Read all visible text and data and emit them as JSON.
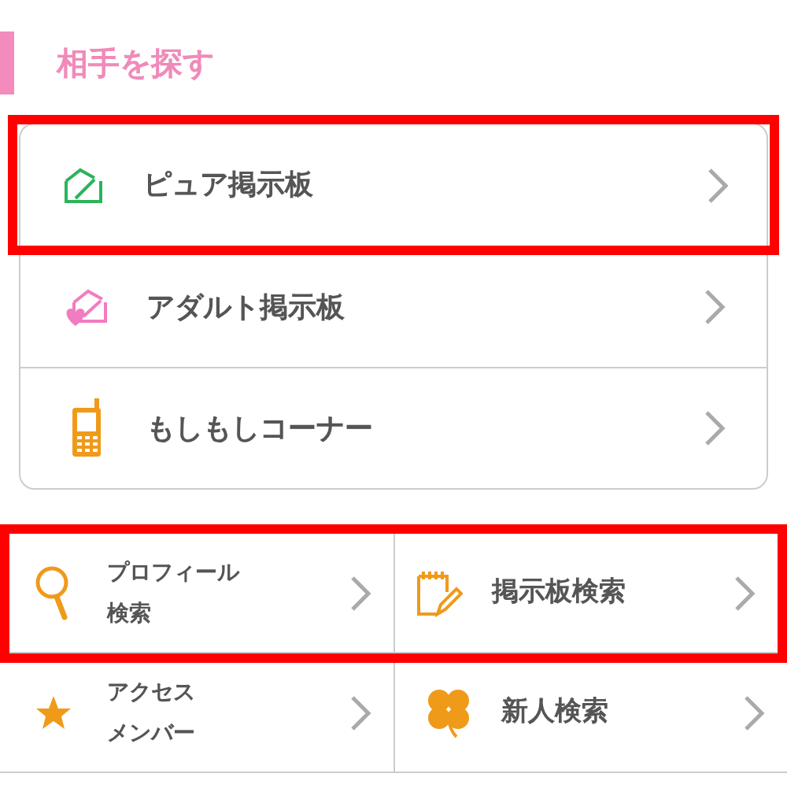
{
  "section": {
    "title": "相手を探す"
  },
  "list": [
    {
      "label": "ピュア掲示板",
      "highlighted": true
    },
    {
      "label": "アダルト掲示板",
      "highlighted": false
    },
    {
      "label": "もしもしコーナー",
      "highlighted": false
    }
  ],
  "grid": [
    {
      "highlighted": true,
      "cells": [
        {
          "lines": [
            "プロフィール",
            "検索"
          ]
        },
        {
          "lines": [
            "掲示板検索"
          ]
        }
      ]
    },
    {
      "highlighted": false,
      "cells": [
        {
          "lines": [
            "アクセス",
            "メンバー"
          ]
        },
        {
          "lines": [
            "新人検索"
          ]
        }
      ]
    }
  ]
}
